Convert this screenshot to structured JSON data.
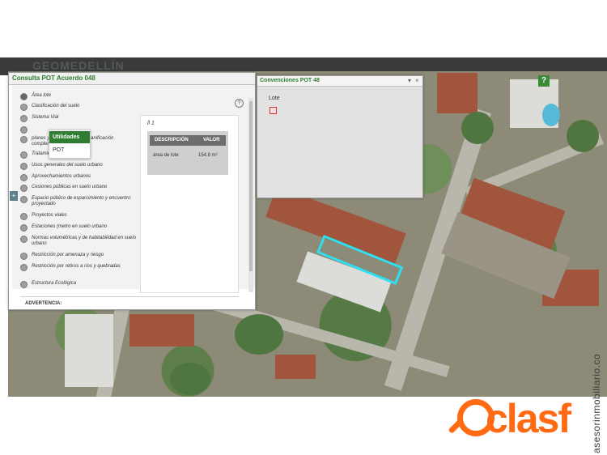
{
  "brand": "GEOMEDELLÍN",
  "left_panel": {
    "title": "Consulta POT Acuerdo 048",
    "options": [
      "Área lote",
      "Clasificación del suelo",
      "Sistema Vial",
      "",
      "planes y instrumentos de planificación complementaria",
      "Tratamientos urbanos",
      "Usos generales del suelo urbano",
      "Aprovechamientos urbanos",
      "Cesiones públicas en suelo urbano",
      "Espacio público de esparcimiento y encuentro proyectado",
      "Proyectos viales",
      "Estaciones (metro en suelo urbano",
      "Normas volumétricas y de habitabilidad en suelo urbano",
      "Restricción por amenaza y riesgo",
      "Restricción por retiros a ríos y quebradas",
      "Estructura Ecológica"
    ],
    "selected_index": 0,
    "help_label": "?",
    "expander_label": "+",
    "popup_menu": [
      "Utilidades",
      "POT"
    ],
    "info": {
      "tab": "ll 1",
      "col_description": "DESCRIPCIÓN",
      "col_value": "VALOR",
      "row_label": "área de lote",
      "row_value": "154.8 m²"
    },
    "warning": "ADVERTENCIA:"
  },
  "legend_panel": {
    "title": "Convenciones POT 48",
    "minimize": "▾",
    "close": "×",
    "label": "Lote",
    "swatch_color": "#d33333"
  },
  "map": {
    "help_button": "?",
    "highlight_color": "#2de0f0"
  },
  "watermark": {
    "text": "clasf",
    "email": "asesorinmobiliario.co"
  }
}
